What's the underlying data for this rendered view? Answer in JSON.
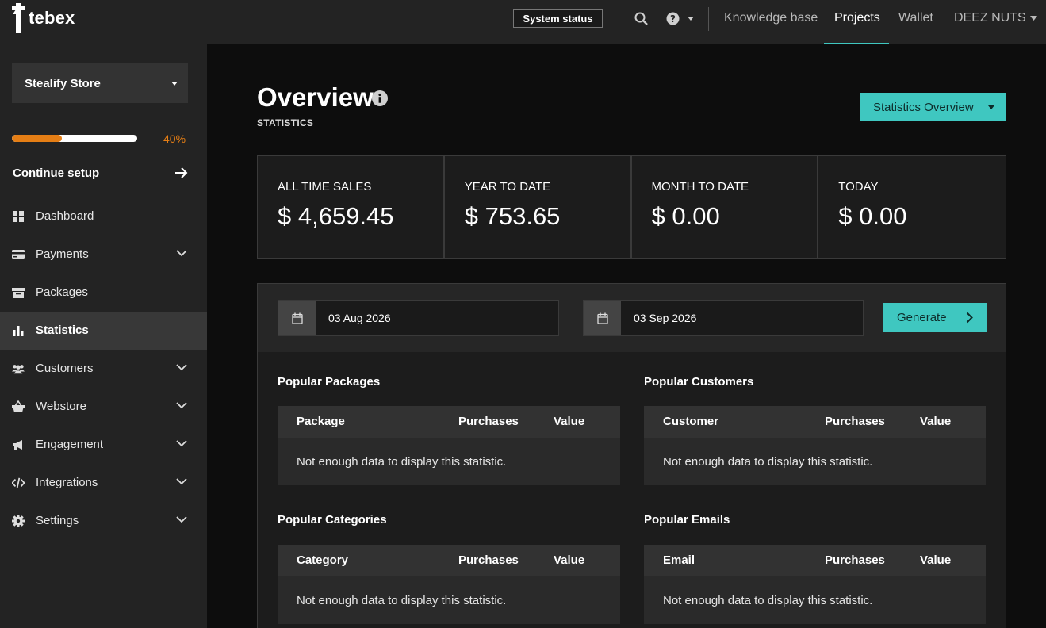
{
  "header": {
    "logo_text": "tebex",
    "system_status": "System status",
    "links": [
      "Knowledge base",
      "Projects",
      "Wallet"
    ],
    "user": "DEEZ NUTS"
  },
  "sidebar": {
    "store": "Stealify Store",
    "progress_percent": 40,
    "progress_label": "40%",
    "continue_setup": "Continue setup",
    "items": [
      {
        "label": "Dashboard",
        "icon": "dashboard-icon"
      },
      {
        "label": "Payments",
        "icon": "card-icon"
      },
      {
        "label": "Packages",
        "icon": "box-icon"
      },
      {
        "label": "Statistics",
        "icon": "bar-chart-icon"
      },
      {
        "label": "Customers",
        "icon": "users-icon"
      },
      {
        "label": "Webstore",
        "icon": "basket-icon"
      },
      {
        "label": "Engagement",
        "icon": "megaphone-icon"
      },
      {
        "label": "Integrations",
        "icon": "code-icon"
      },
      {
        "label": "Settings",
        "icon": "gear-icon"
      }
    ]
  },
  "main": {
    "title": "Overview",
    "subtitle": "STATISTICS",
    "stat_button": "Statistics Overview",
    "cards": [
      {
        "label": "ALL TIME SALES",
        "value": "$ 4,659.45"
      },
      {
        "label": "YEAR TO DATE",
        "value": "$ 753.65"
      },
      {
        "label": "MONTH TO DATE",
        "value": "$ 0.00"
      },
      {
        "label": "TODAY",
        "value": "$ 0.00"
      }
    ],
    "date_from": "03 Aug 2026",
    "date_to": "03 Sep 2026",
    "generate": "Generate",
    "sections": [
      {
        "title": "Popular Packages",
        "col1": "Package",
        "col2": "Purchases",
        "col3": "Value",
        "empty": "Not enough data to display this statistic."
      },
      {
        "title": "Popular Customers",
        "col1": "Customer",
        "col2": "Purchases",
        "col3": "Value",
        "empty": "Not enough data to display this statistic."
      },
      {
        "title": "Popular Categories",
        "col1": "Category",
        "col2": "Purchases",
        "col3": "Value",
        "empty": "Not enough data to display this statistic."
      },
      {
        "title": "Popular Emails",
        "col1": "Email",
        "col2": "Purchases",
        "col3": "Value",
        "empty": "Not enough data to display this statistic."
      }
    ]
  },
  "colors": {
    "accent": "#3fc7c0",
    "progress": "#e57e15"
  }
}
